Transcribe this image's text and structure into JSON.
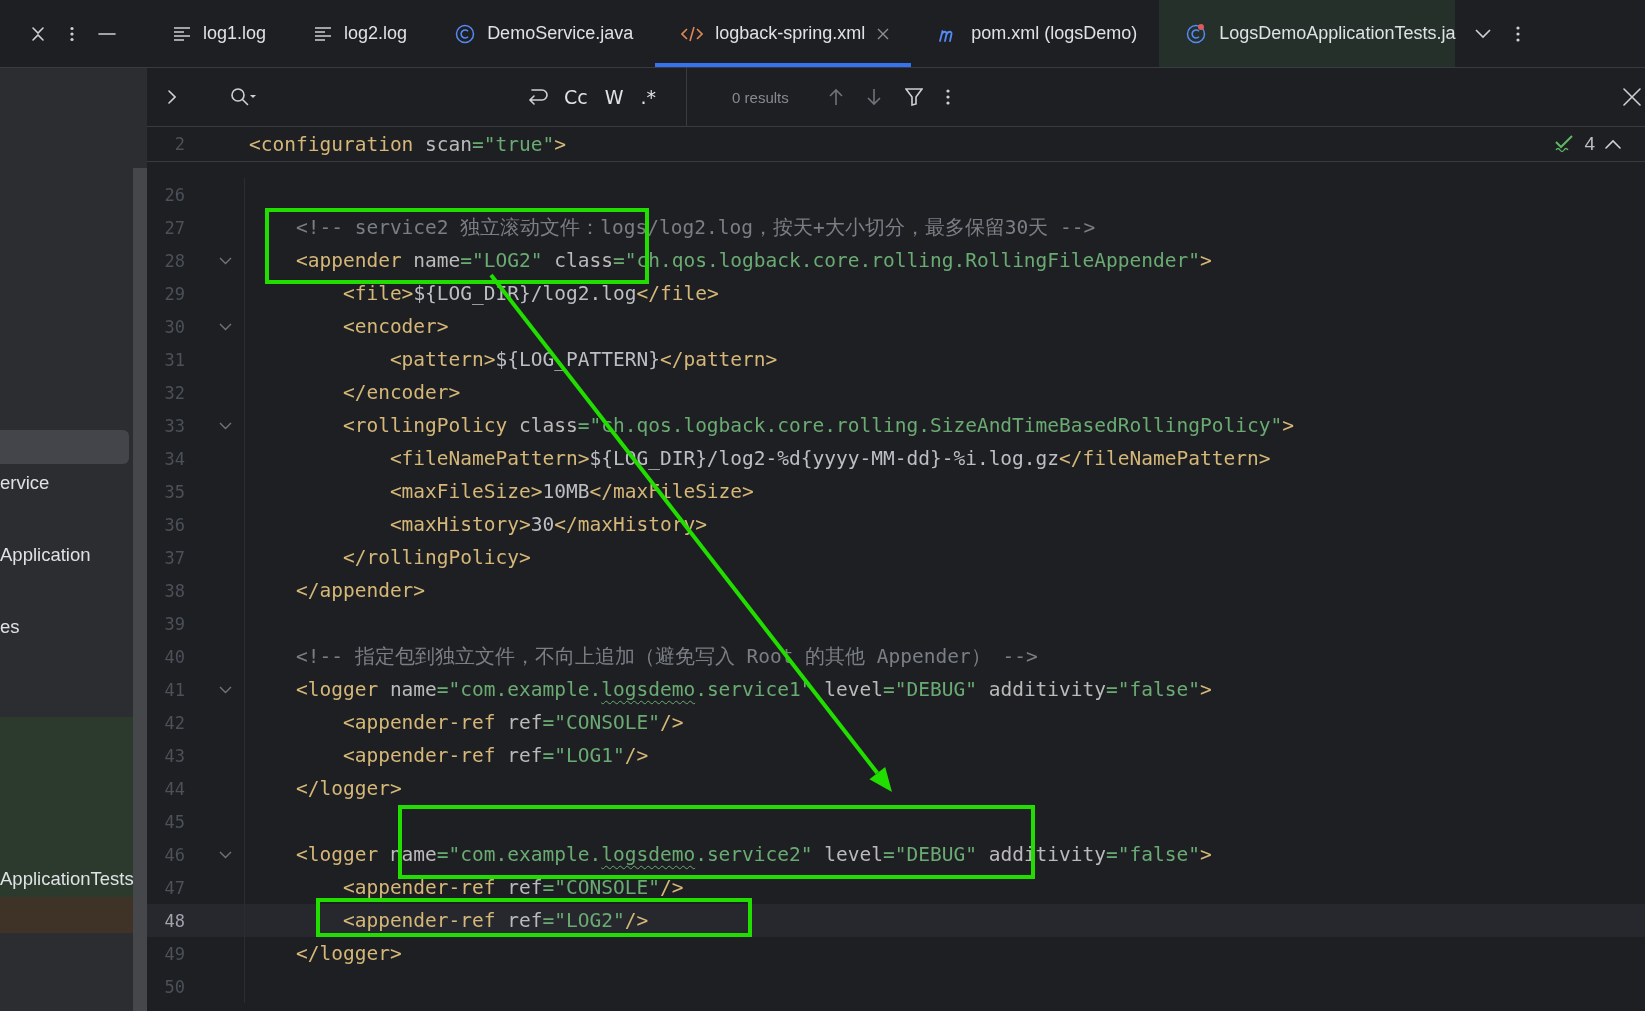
{
  "tab_bar": {
    "tabs": [
      {
        "label": "log1.log",
        "selected": false
      },
      {
        "label": "log2.log",
        "selected": false
      },
      {
        "label": "DemoService.java",
        "selected": false
      },
      {
        "label": "logback-spring.xml",
        "selected": true
      },
      {
        "label": "pom.xml (logsDemo)",
        "selected": false
      },
      {
        "label": "LogsDemoApplicationTests.ja",
        "selected": false
      }
    ]
  },
  "find_bar": {
    "options": [
      "Cc",
      "W",
      ".*"
    ],
    "results": "0 results"
  },
  "sidebar": {
    "items": [
      {
        "selected": true
      },
      {
        "label": "ervice",
        "selected": false
      },
      {
        "selected": false
      },
      {
        "label": "Application",
        "selected": false
      },
      {
        "selected": false
      },
      {
        "label": "es",
        "selected": false
      },
      {
        "selected": false
      },
      {
        "selected": false
      },
      {
        "selected": false,
        "color": "#2b3a2c"
      },
      {
        "selected": false,
        "color": "#2b3a2c"
      },
      {
        "selected": false,
        "color": "#2b3a2c"
      },
      {
        "selected": false,
        "color": "#2b3a2c"
      },
      {
        "label": "ApplicationTests",
        "selected": false,
        "color": "#2b3a2c"
      },
      {
        "selected": false,
        "color": "#3e3326"
      }
    ]
  },
  "editor": {
    "inspections": {
      "count": "4"
    },
    "sticky_line": {
      "number": "2",
      "tokens": [
        {
          "kind": "tag",
          "text": "<configuration"
        },
        {
          "kind": "attr",
          "text": " scan"
        },
        {
          "kind": "value",
          "text": "=\"true\""
        },
        {
          "kind": "tag",
          "text": ">"
        }
      ]
    },
    "lines": [
      {
        "number": "26",
        "foldable": false,
        "current": false
      },
      {
        "number": "27",
        "foldable": false,
        "current": false,
        "tokens": [
          {
            "kind": "comment",
            "text": "    <!-- service2 独立滚动文件：logs/log2.log，按天+大小切分，最多保留30天 -->"
          }
        ]
      },
      {
        "number": "28",
        "foldable": true,
        "current": false,
        "tokens": [
          {
            "kind": "tag",
            "text": "    <appender"
          },
          {
            "kind": "attr",
            "text": " name"
          },
          {
            "kind": "value",
            "text": "=\"LOG2\""
          },
          {
            "kind": "attr",
            "text": " class"
          },
          {
            "kind": "value",
            "text": "=\"ch.qos.logback.core.rolling.RollingFileAppender\""
          },
          {
            "kind": "tag",
            "text": ">"
          }
        ]
      },
      {
        "number": "29",
        "foldable": false,
        "current": false,
        "tokens": [
          {
            "kind": "tag",
            "text": "        <file>"
          },
          {
            "kind": "plain",
            "text": "${LOG_DIR}/log2.log"
          },
          {
            "kind": "tag",
            "text": "</file>"
          }
        ]
      },
      {
        "number": "30",
        "foldable": true,
        "current": false,
        "tokens": [
          {
            "kind": "tag",
            "text": "        <encoder>"
          }
        ]
      },
      {
        "number": "31",
        "foldable": false,
        "current": false,
        "tokens": [
          {
            "kind": "tag",
            "text": "            <pattern>"
          },
          {
            "kind": "plain",
            "text": "${LOG_PATTERN}"
          },
          {
            "kind": "tag",
            "text": "</pattern>"
          }
        ]
      },
      {
        "number": "32",
        "foldable": false,
        "current": false,
        "tokens": [
          {
            "kind": "tag",
            "text": "        </encoder>"
          }
        ]
      },
      {
        "number": "33",
        "foldable": true,
        "current": false,
        "tokens": [
          {
            "kind": "tag",
            "text": "        <rollingPolicy"
          },
          {
            "kind": "attr",
            "text": " class"
          },
          {
            "kind": "value",
            "text": "=\"ch.qos.logback.core.rolling.SizeAndTimeBasedRollingPolicy\""
          },
          {
            "kind": "tag",
            "text": ">"
          }
        ]
      },
      {
        "number": "34",
        "foldable": false,
        "current": false,
        "tokens": [
          {
            "kind": "tag",
            "text": "            <fileNamePattern>"
          },
          {
            "kind": "plain",
            "text": "${LOG_DIR}/log2-%d{yyyy-MM-dd}-%i.log.gz"
          },
          {
            "kind": "tag",
            "text": "</fileNamePattern>"
          }
        ]
      },
      {
        "number": "35",
        "foldable": false,
        "current": false,
        "tokens": [
          {
            "kind": "tag",
            "text": "            <maxFileSize>"
          },
          {
            "kind": "plain",
            "text": "10MB"
          },
          {
            "kind": "tag",
            "text": "</maxFileSize>"
          }
        ]
      },
      {
        "number": "36",
        "foldable": false,
        "current": false,
        "tokens": [
          {
            "kind": "tag",
            "text": "            <maxHistory>"
          },
          {
            "kind": "plain",
            "text": "30"
          },
          {
            "kind": "tag",
            "text": "</maxHistory>"
          }
        ]
      },
      {
        "number": "37",
        "foldable": false,
        "current": false,
        "tokens": [
          {
            "kind": "tag",
            "text": "        </rollingPolicy>"
          }
        ]
      },
      {
        "number": "38",
        "foldable": false,
        "current": false,
        "tokens": [
          {
            "kind": "tag",
            "text": "    </appender>"
          }
        ]
      },
      {
        "number": "39",
        "foldable": false,
        "current": false
      },
      {
        "number": "40",
        "foldable": false,
        "current": false,
        "tokens": [
          {
            "kind": "comment",
            "text": "    <!-- 指定包到独立文件，不向上追加（避免写入 Root 的其他 Appender） -->"
          }
        ]
      },
      {
        "number": "41",
        "foldable": true,
        "current": false,
        "tokens": [
          {
            "kind": "tag",
            "text": "    <logger"
          },
          {
            "kind": "attr",
            "text": " name"
          },
          {
            "kind": "value",
            "text": "=\"com.example."
          },
          {
            "kind": "typo",
            "text": "logsdemo"
          },
          {
            "kind": "value",
            "text": ".service1\""
          },
          {
            "kind": "attr",
            "text": " level"
          },
          {
            "kind": "value",
            "text": "=\"DEBUG\""
          },
          {
            "kind": "attr",
            "text": " additivity"
          },
          {
            "kind": "value",
            "text": "=\"false\""
          },
          {
            "kind": "tag",
            "text": ">"
          }
        ]
      },
      {
        "number": "42",
        "foldable": false,
        "current": false,
        "tokens": [
          {
            "kind": "tag",
            "text": "        <appender-ref"
          },
          {
            "kind": "attr",
            "text": " ref"
          },
          {
            "kind": "value",
            "text": "=\"CONSOLE\""
          },
          {
            "kind": "tag",
            "text": "/>"
          }
        ]
      },
      {
        "number": "43",
        "foldable": false,
        "current": false,
        "tokens": [
          {
            "kind": "tag",
            "text": "        <appender-ref"
          },
          {
            "kind": "attr",
            "text": " ref"
          },
          {
            "kind": "value",
            "text": "=\"LOG1\""
          },
          {
            "kind": "tag",
            "text": "/>"
          }
        ]
      },
      {
        "number": "44",
        "foldable": false,
        "current": false,
        "tokens": [
          {
            "kind": "tag",
            "text": "    </logger>"
          }
        ]
      },
      {
        "number": "45",
        "foldable": false,
        "current": false
      },
      {
        "number": "46",
        "foldable": true,
        "current": false,
        "tokens": [
          {
            "kind": "tag",
            "text": "    <logger"
          },
          {
            "kind": "attr",
            "text": " name"
          },
          {
            "kind": "value",
            "text": "=\"com.example."
          },
          {
            "kind": "typo",
            "text": "logsdemo"
          },
          {
            "kind": "value",
            "text": ".service2\""
          },
          {
            "kind": "attr",
            "text": " level"
          },
          {
            "kind": "value",
            "text": "=\"DEBUG\""
          },
          {
            "kind": "attr",
            "text": " additivity"
          },
          {
            "kind": "value",
            "text": "=\"false\""
          },
          {
            "kind": "tag",
            "text": ">"
          }
        ]
      },
      {
        "number": "47",
        "foldable": false,
        "current": false,
        "tokens": [
          {
            "kind": "tag",
            "text": "        <appender-ref"
          },
          {
            "kind": "attr",
            "text": " ref"
          },
          {
            "kind": "value",
            "text": "=\"CONSOLE\""
          },
          {
            "kind": "tag",
            "text": "/>"
          }
        ]
      },
      {
        "number": "48",
        "foldable": false,
        "current": true,
        "tokens": [
          {
            "kind": "tag",
            "text": "        <appender-ref"
          },
          {
            "kind": "attr",
            "text": " ref"
          },
          {
            "kind": "value",
            "text": "=\"LOG2\""
          },
          {
            "kind": "tag",
            "text": "/>"
          }
        ]
      },
      {
        "number": "49",
        "foldable": false,
        "current": false,
        "tokens": [
          {
            "kind": "tag",
            "text": "    </logger>"
          }
        ]
      },
      {
        "number": "50",
        "foldable": false,
        "current": false
      }
    ]
  },
  "annotations": [
    {
      "kind": "box"
    },
    {
      "kind": "arrow"
    },
    {
      "kind": "box"
    },
    {
      "kind": "box"
    }
  ]
}
